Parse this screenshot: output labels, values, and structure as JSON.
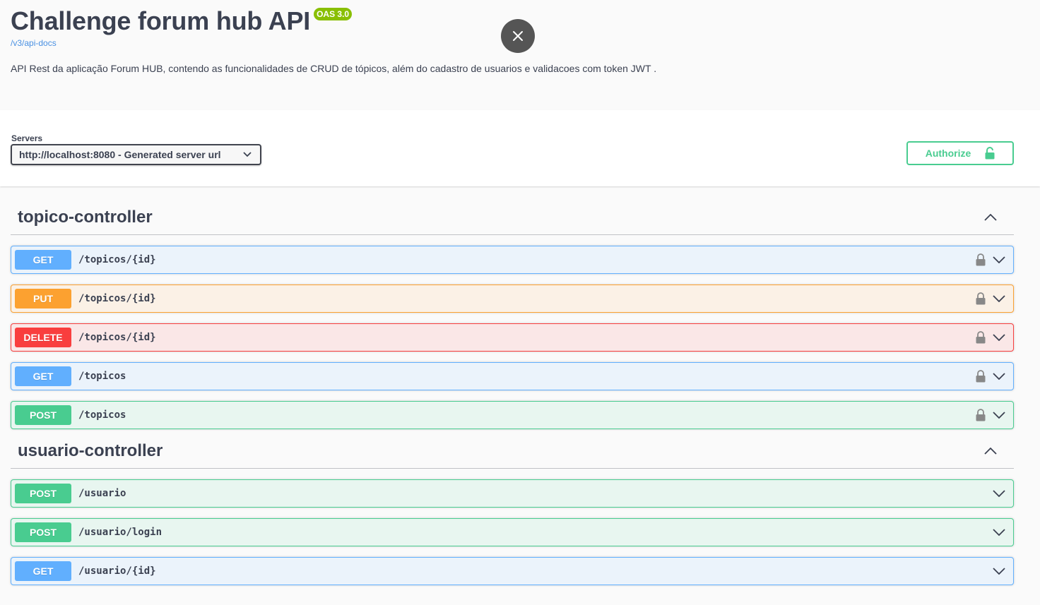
{
  "info": {
    "title": "Challenge forum hub API",
    "badge": "OAS 3.0",
    "spec_link": "/v3/api-docs",
    "description": "API Rest da aplicação Forum HUB, contendo as funcionalidades de CRUD de tópicos, além do cadastro de usuarios e validacoes com token JWT ."
  },
  "servers": {
    "label": "Servers",
    "selected": "http://localhost:8080 - Generated server url"
  },
  "authorize": {
    "label": "Authorize"
  },
  "tags": [
    {
      "name": "topico-controller",
      "operations": [
        {
          "method": "GET",
          "path": "/topicos/{id}",
          "locked": true
        },
        {
          "method": "PUT",
          "path": "/topicos/{id}",
          "locked": true
        },
        {
          "method": "DELETE",
          "path": "/topicos/{id}",
          "locked": true
        },
        {
          "method": "GET",
          "path": "/topicos",
          "locked": true
        },
        {
          "method": "POST",
          "path": "/topicos",
          "locked": true
        }
      ]
    },
    {
      "name": "usuario-controller",
      "operations": [
        {
          "method": "POST",
          "path": "/usuario",
          "locked": false
        },
        {
          "method": "POST",
          "path": "/usuario/login",
          "locked": false
        },
        {
          "method": "GET",
          "path": "/usuario/{id}",
          "locked": false
        }
      ]
    }
  ],
  "colors": {
    "get": "#61affe",
    "put": "#fca130",
    "delete": "#f93e3e",
    "post": "#49cc90",
    "badge": "#89bf04",
    "link": "#4990e2"
  }
}
